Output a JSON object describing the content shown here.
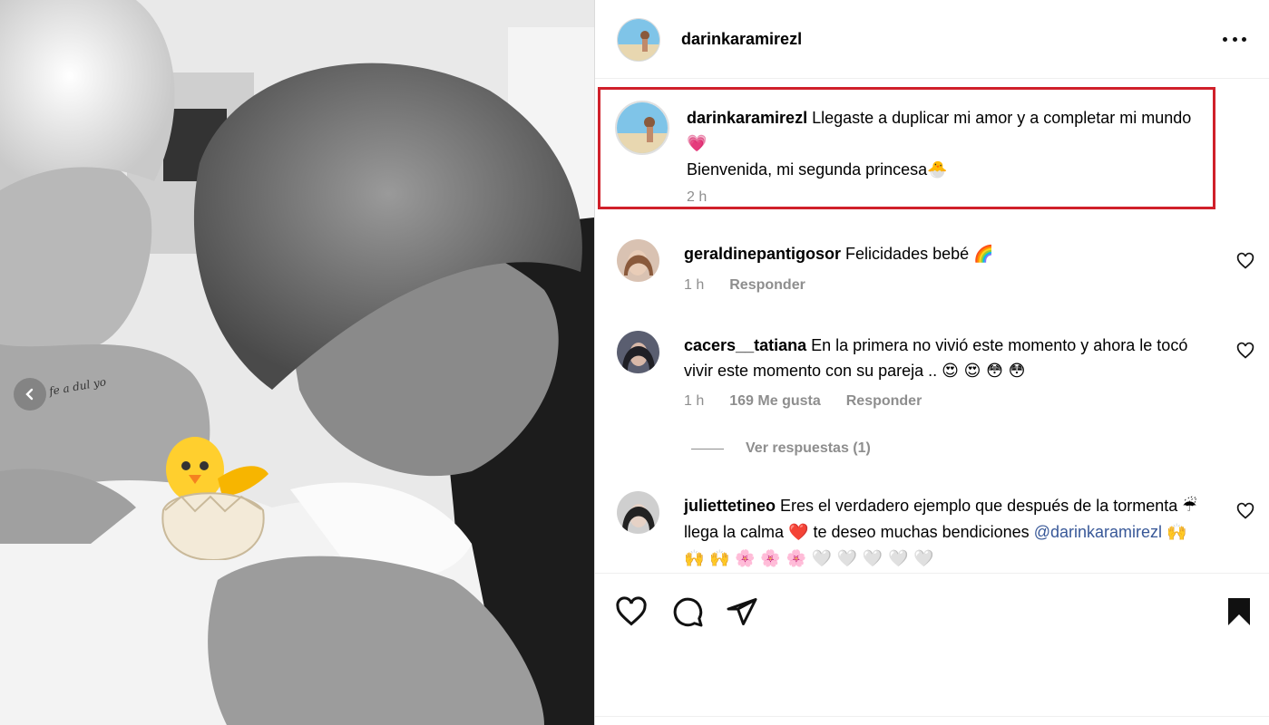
{
  "post": {
    "username": "darinkaramirezl",
    "caption": {
      "username": "darinkaramirezl",
      "line1": "Llegaste a duplicar mi amor y a completar mi mundo",
      "line1_emoji": "💗",
      "line2": "Bienvenida, mi segunda princesa",
      "line2_emoji": "🐣",
      "time": "2 h"
    }
  },
  "comments": [
    {
      "username": "geraldinepantigosor",
      "text": "Felicidades bebé",
      "emoji": "🌈",
      "time": "1 h",
      "reply_label": "Responder"
    },
    {
      "username": "cacers__tatiana",
      "text": "En la primera no vivió este momento y ahora le tocó vivir este momento con su pareja ..",
      "emoji": "😍 😍 😳 😳",
      "time": "1 h",
      "likes": "169 Me gusta",
      "reply_label": "Responder"
    },
    {
      "username": "juliettetineo",
      "text_a": "Eres el verdadero ejemplo que después de la tormenta",
      "emoji_a": "☔",
      "text_b": "llega la calma",
      "emoji_b": "❤️",
      "text_c": "te deseo muchas bendiciones",
      "mention": "@darinkaramirezl",
      "emoji_c": "🙌 🙌 🙌 🌸 🌸 🌸 🤍 🤍 🤍 🤍 🤍"
    }
  ],
  "view_replies": "Ver respuestas (1)",
  "photo": {
    "tattoo_text": "fe a dul yo",
    "sticker": "🐣"
  },
  "icons": {
    "prev": "chevron-left-icon",
    "more": "more-options-icon",
    "like": "heart-icon",
    "comment": "comment-icon",
    "share": "send-icon",
    "save": "bookmark-icon"
  }
}
